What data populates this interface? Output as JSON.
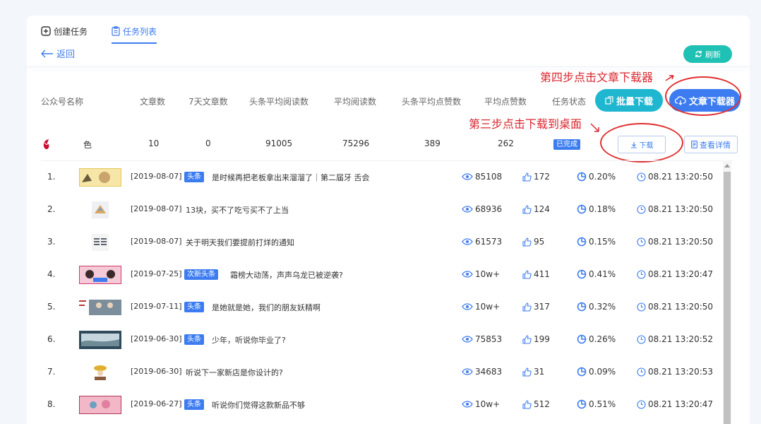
{
  "tabs": [
    {
      "label": "创建任务",
      "icon": "plus-square-icon"
    },
    {
      "label": "任务列表",
      "icon": "clipboard-icon"
    }
  ],
  "back_label": "返回",
  "refresh_label": "刷新",
  "headers": {
    "account": "公众号名称",
    "articles": "文章数",
    "articles_7d": "7天文章数",
    "head_avg_read": "头条平均阅读数",
    "avg_read": "平均阅读数",
    "head_avg_like": "头条平均点赞数",
    "avg_like": "平均点赞数",
    "status": "任务状态"
  },
  "batch_download_label": "批量下载",
  "article_downloader_label": "文章下载器",
  "annotations": {
    "step4": "第四步点击文章下载器",
    "step3": "第三步点击下载到桌面"
  },
  "summary": {
    "account_name": "色",
    "articles": "10",
    "articles_7d": "0",
    "head_avg_read": "91005",
    "avg_read": "75296",
    "head_avg_like": "389",
    "avg_like": "262",
    "status": "已完成",
    "download_label": "下载",
    "detail_label": "查看详情"
  },
  "rows": [
    {
      "index": "1.",
      "date": "[2019-08-07]",
      "tag": "头条",
      "title": "是时候再把老板拿出来溜溜了｜第二届牙   舌会",
      "reads": "85108",
      "likes": "172",
      "rate": "0.20%",
      "time": "08.21 13:20:50"
    },
    {
      "index": "2.",
      "date": "[2019-08-07]",
      "tag": "",
      "title": "13块，买不了吃亏买不了上当",
      "reads": "68936",
      "likes": "124",
      "rate": "0.18%",
      "time": "08.21 13:20:50"
    },
    {
      "index": "3.",
      "date": "[2019-08-07]",
      "tag": "",
      "title": "关于明天我们要提前打烊的通知",
      "reads": "61573",
      "likes": "95",
      "rate": "0.15%",
      "time": "08.21 13:20:50"
    },
    {
      "index": "4.",
      "date": "[2019-07-25]",
      "tag": "次新头条",
      "title": "霜榜大动荡，声声乌龙已被逆袭?",
      "reads": "10w+",
      "likes": "411",
      "rate": "0.41%",
      "time": "08.21 13:20:47"
    },
    {
      "index": "5.",
      "date": "[2019-07-11]",
      "tag": "头条",
      "title": "是她就是她，我们的朋友妖精啊",
      "reads": "10w+",
      "likes": "317",
      "rate": "0.32%",
      "time": "08.21 13:20:50"
    },
    {
      "index": "6.",
      "date": "[2019-06-30]",
      "tag": "头条",
      "title": "少年，听说你毕业了?",
      "reads": "75853",
      "likes": "199",
      "rate": "0.26%",
      "time": "08.21 13:20:52"
    },
    {
      "index": "7.",
      "date": "[2019-06-30]",
      "tag": "",
      "title": "听说下一家新店是你设计的?",
      "reads": "34683",
      "likes": "31",
      "rate": "0.09%",
      "time": "08.21 13:20:53"
    },
    {
      "index": "8.",
      "date": "[2019-06-27]",
      "tag": "头条",
      "title": "听说你们觉得这款新品不够",
      "reads": "10w+",
      "likes": "512",
      "rate": "0.51%",
      "time": "08.21 13:20:47"
    }
  ],
  "colors": {
    "accent": "#3d7cf0",
    "teal": "#1fc1b4",
    "batch": "#1fb6d0",
    "annotation": "#d9262e"
  }
}
